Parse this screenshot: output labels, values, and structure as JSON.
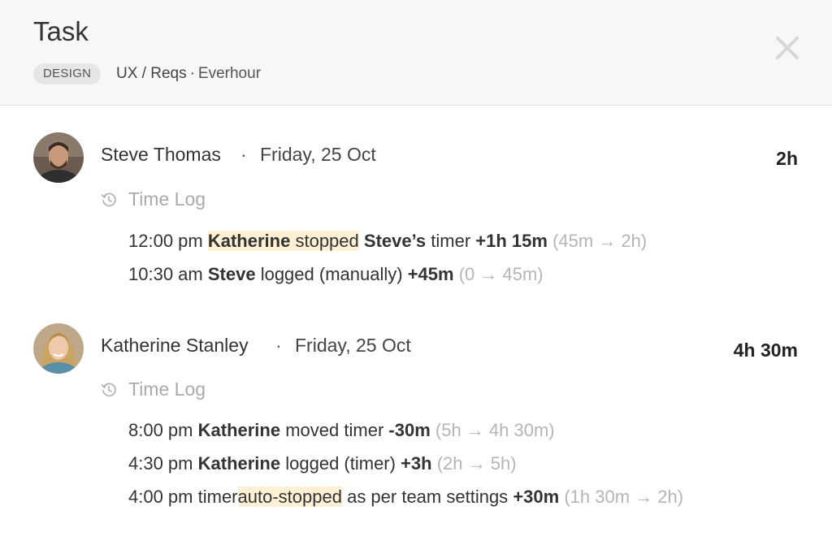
{
  "header": {
    "title": "Task",
    "tag": "DESIGN",
    "breadcrumb": {
      "path": "UX / Reqs",
      "separator": "·",
      "project": "Everhour"
    }
  },
  "entries": [
    {
      "user": "Steve Thomas",
      "dot": "·",
      "date": "Friday, 25 Oct",
      "total": "2h",
      "section_label": "Time Log",
      "lines": [
        {
          "time": "12:00 pm",
          "actor": "Katherine",
          "action": "stopped",
          "subject": "Steve’s",
          "rest": "timer",
          "delta": "+1h 15m",
          "range": "(45m → 2h)"
        },
        {
          "time": "10:30 am",
          "actor": "Steve",
          "action": "logged (manually)",
          "delta": "+45m",
          "range": "(0 → 45m)"
        }
      ]
    },
    {
      "user": "Katherine Stanley",
      "dot": "·",
      "date": "Friday, 25 Oct",
      "total": "4h 30m",
      "section_label": "Time Log",
      "lines": [
        {
          "time": "8:00 pm",
          "actor": "Katherine",
          "action": "moved timer",
          "delta": "-30m",
          "range": "(5h → 4h 30m)"
        },
        {
          "time": "4:30 pm",
          "actor": "Katherine",
          "action": "logged (timer)",
          "delta": "+3h",
          "range": "(2h → 5h)"
        },
        {
          "time": "4:00 pm",
          "pre": "timer",
          "action": "auto-stopped",
          "rest": "as per team settings",
          "delta": "+30m",
          "range": "(1h 30m → 2h)"
        }
      ]
    }
  ],
  "colors": {
    "highlight": "#fdf0d5",
    "muted": "#b5b5b5",
    "header_bg": "#f7f7f7",
    "tag_bg": "#e6e6e6"
  },
  "icons": {
    "close": "close-icon",
    "history": "history-icon"
  }
}
